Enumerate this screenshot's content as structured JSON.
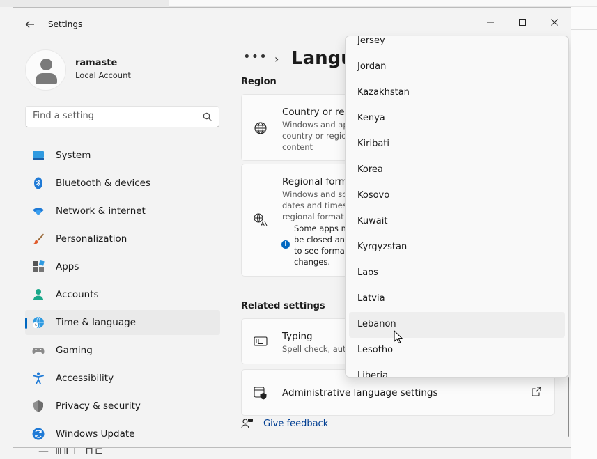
{
  "app": {
    "title": "Settings"
  },
  "window": {
    "minimize": "—",
    "maximize": "☐",
    "close": "✕"
  },
  "background": {
    "bottom_text": "— ⅢⅡ⊤ ⊓⊏"
  },
  "user": {
    "name": "ramaste",
    "account_type": "Local Account"
  },
  "search": {
    "placeholder": "Find a setting"
  },
  "sidebar": {
    "items": [
      {
        "label": "System",
        "icon": "system-icon"
      },
      {
        "label": "Bluetooth & devices",
        "icon": "bluetooth-icon"
      },
      {
        "label": "Network & internet",
        "icon": "wifi-icon"
      },
      {
        "label": "Personalization",
        "icon": "brush-icon"
      },
      {
        "label": "Apps",
        "icon": "apps-icon"
      },
      {
        "label": "Accounts",
        "icon": "accounts-icon"
      },
      {
        "label": "Time & language",
        "icon": "globe-clock-icon",
        "selected": true
      },
      {
        "label": "Gaming",
        "icon": "gamepad-icon"
      },
      {
        "label": "Accessibility",
        "icon": "accessibility-icon"
      },
      {
        "label": "Privacy & security",
        "icon": "shield-icon"
      },
      {
        "label": "Windows Update",
        "icon": "update-icon"
      }
    ]
  },
  "main": {
    "breadcrumb_more": "•••",
    "breadcrumb_sep": "›",
    "page_title": "Langu",
    "region_header": "Region",
    "country_card": {
      "title": "Country or reg",
      "description": "Windows and ap\ncountry or region\ncontent"
    },
    "regional_card": {
      "title": "Regional forma",
      "description": "Windows and sor\ndates and times b\nregional format",
      "info": "Some apps m\nbe closed and\nto see formatt\nchanges."
    },
    "related_header": "Related settings",
    "typing_card": {
      "title": "Typing",
      "description": "Spell check, auto"
    },
    "admin_card": {
      "title": "Administrative language settings"
    },
    "feedback": "Give feedback"
  },
  "dropdown": {
    "options": [
      "Jersey",
      "Jordan",
      "Kazakhstan",
      "Kenya",
      "Kiribati",
      "Korea",
      "Kosovo",
      "Kuwait",
      "Kyrgyzstan",
      "Laos",
      "Latvia",
      "Lebanon",
      "Lesotho",
      "Liberia"
    ],
    "hovered": "Lebanon"
  },
  "colors": {
    "accent": "#0067c0",
    "link": "#003e92",
    "window_bg": "#f3f3f3",
    "card_bg": "#fbfbfb",
    "selected_nav_bg": "#eaeaea"
  }
}
